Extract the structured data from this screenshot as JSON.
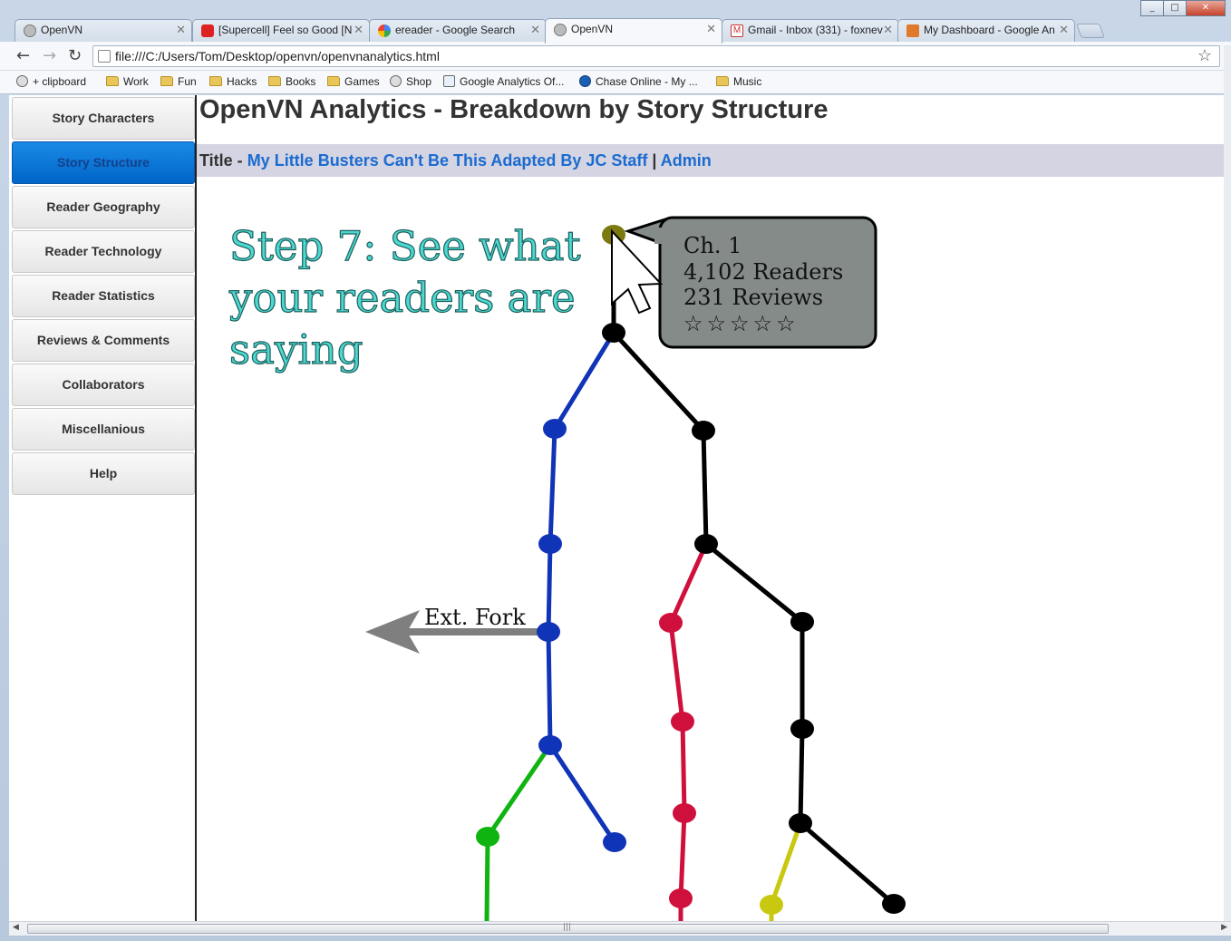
{
  "browser": {
    "tabs": [
      {
        "label": "OpenVN",
        "icon": "globe-icon"
      },
      {
        "label": "[Supercell] Feel so Good [N",
        "icon": "youtube-icon"
      },
      {
        "label": "ereader - Google Search",
        "icon": "google-icon"
      },
      {
        "label": "OpenVN",
        "icon": "globe-icon",
        "active": true
      },
      {
        "label": "Gmail - Inbox (331) - foxnev",
        "icon": "gmail-icon"
      },
      {
        "label": "My Dashboard - Google An",
        "icon": "analytics-icon"
      }
    ],
    "url": "file:///C:/Users/Tom/Desktop/openvn/openvnanalytics.html",
    "bookmarks": [
      {
        "label": "+ clipboard",
        "icon": "globe-icon"
      },
      {
        "label": "Work",
        "icon": "folder-icon"
      },
      {
        "label": "Fun",
        "icon": "folder-icon"
      },
      {
        "label": "Hacks",
        "icon": "folder-icon"
      },
      {
        "label": "Books",
        "icon": "folder-icon"
      },
      {
        "label": "Games",
        "icon": "folder-icon"
      },
      {
        "label": "Shop",
        "icon": "globe-icon"
      },
      {
        "label": "Google Analytics Of...",
        "icon": "analytics-icon"
      },
      {
        "label": "Chase Online - My ...",
        "icon": "chase-icon"
      },
      {
        "label": "Music",
        "icon": "folder-icon"
      }
    ]
  },
  "sidebar": {
    "items": [
      {
        "label": "Story Characters"
      },
      {
        "label": "Story Structure",
        "active": true
      },
      {
        "label": "Reader Geography"
      },
      {
        "label": "Reader Technology"
      },
      {
        "label": "Reader Statistics"
      },
      {
        "label": "Reviews & Comments"
      },
      {
        "label": "Collaborators"
      },
      {
        "label": "Miscellanious"
      },
      {
        "label": "Help"
      }
    ]
  },
  "main": {
    "title": "OpenVN Analytics - Breakdown by Story Structure",
    "title_prefix": "Title -",
    "story_link": "My Little Busters Can't Be This Adapted By JC Staff",
    "separator": "|",
    "admin_link": "Admin"
  },
  "diagram": {
    "step_line1": "Step 7: See what",
    "step_line2": "your readers are",
    "step_line3": "saying",
    "tooltip": {
      "chapter": "Ch. 1",
      "readers": "4,102 Readers",
      "reviews": "231 Reviews",
      "stars": "☆☆☆☆☆"
    },
    "fork_label": "Ext. Fork",
    "colors": {
      "root": "#000000",
      "blue": "#1034b8",
      "red": "#d0103c",
      "green": "#10b410",
      "yellow": "#c8c810",
      "selected": "#7a7a10"
    }
  }
}
